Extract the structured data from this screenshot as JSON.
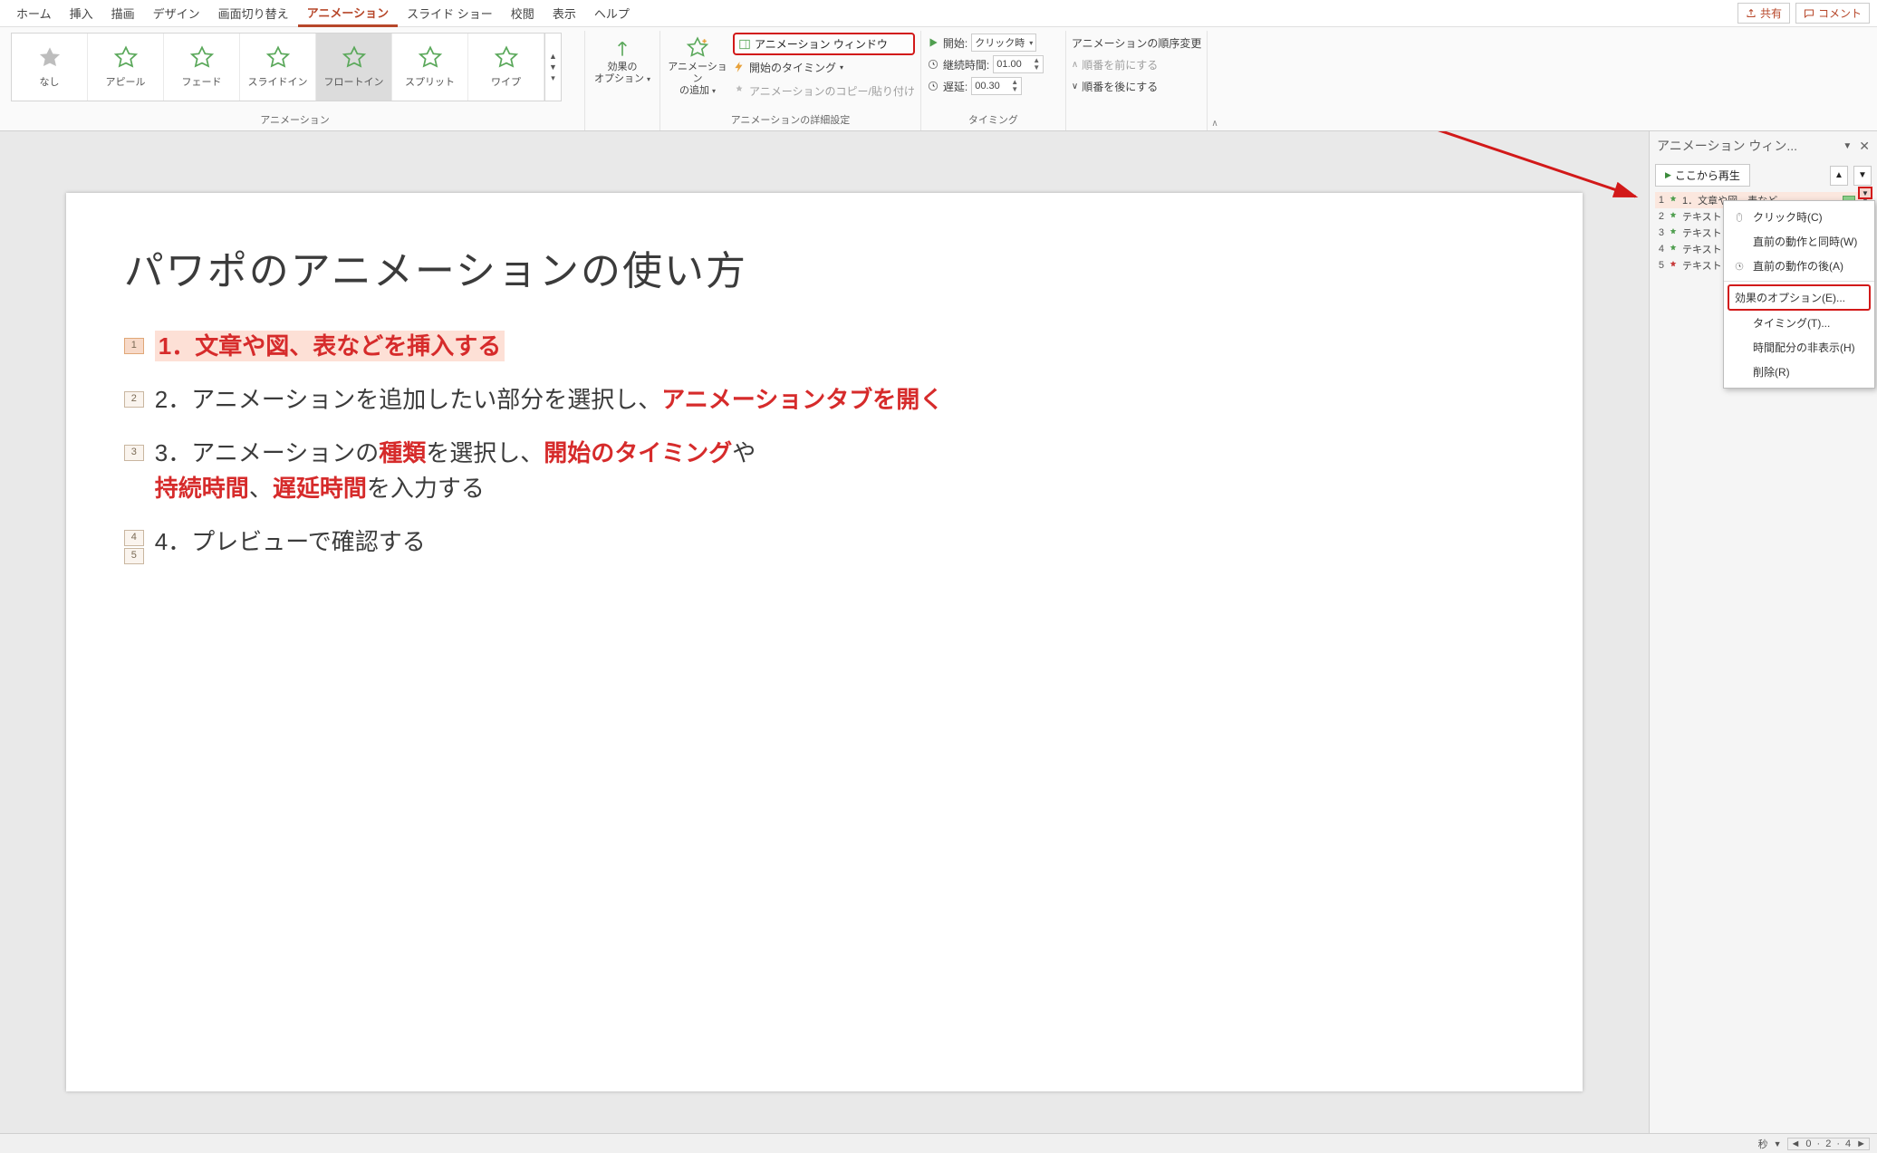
{
  "tabs": {
    "items": [
      "ホーム",
      "挿入",
      "描画",
      "デザイン",
      "画面切り替え",
      "アニメーション",
      "スライド ショー",
      "校閲",
      "表示",
      "ヘルプ"
    ],
    "active_index": 5,
    "share": "共有",
    "comment": "コメント"
  },
  "gallery": {
    "items": [
      {
        "label": "なし",
        "color": "#9e9e9e"
      },
      {
        "label": "アピール",
        "color": "#7fc77f"
      },
      {
        "label": "フェード",
        "color": "#7fc77f"
      },
      {
        "label": "スライドイン",
        "color": "#7fc77f"
      },
      {
        "label": "フロートイン",
        "color": "#7fc77f",
        "selected": true
      },
      {
        "label": "スプリット",
        "color": "#7fc77f"
      },
      {
        "label": "ワイプ",
        "color": "#7fc77f"
      }
    ],
    "group_label": "アニメーション"
  },
  "effect_options": {
    "line1": "効果の",
    "line2": "オプション"
  },
  "add_anim": {
    "line1": "アニメーション",
    "line2": "の追加"
  },
  "adv": {
    "pane_btn": "アニメーション ウィンドウ",
    "trigger": "開始のタイミング",
    "painter": "アニメーションのコピー/貼り付け",
    "group_label": "アニメーションの詳細設定"
  },
  "timing": {
    "start_label": "開始:",
    "start_value": "クリック時",
    "duration_label": "継続時間:",
    "duration_value": "01.00",
    "delay_label": "遅延:",
    "delay_value": "00.30",
    "reorder_label": "アニメーションの順序変更",
    "earlier": "順番を前にする",
    "later": "順番を後にする",
    "group_label": "タイミング"
  },
  "slide": {
    "title": "パワポのアニメーションの使い方",
    "rows": [
      {
        "tags": [
          "1"
        ],
        "num": "1．",
        "pre": "",
        "red": "文章や図、表などを挿入する",
        "post": "",
        "selected": true
      },
      {
        "tags": [
          "2"
        ],
        "num": "2．",
        "pre": "アニメーションを追加したい部分を選択し、",
        "red": "アニメーションタブを開く",
        "post": ""
      },
      {
        "tags": [
          "3"
        ],
        "num": "3．",
        "pre": "アニメーションの",
        "mid_red1": "種類",
        "mid_plain1": "を選択し、",
        "mid_red2": "開始のタイミング",
        "mid_plain2": "や",
        "mid_red3": "持続時間",
        "mid_plain3": "、",
        "mid_red4": "遅延時間",
        "post": "を入力する"
      },
      {
        "tags": [
          "4",
          "5"
        ],
        "num": "4．",
        "pre": "プレビューで確認する",
        "red": "",
        "post": ""
      }
    ]
  },
  "pane": {
    "title": "アニメーション ウィン...",
    "play": "ここから再生",
    "items": [
      {
        "idx": "1",
        "label": "1．文章や図、表など...",
        "sel": true,
        "bar": true
      },
      {
        "idx": "2",
        "label": "テキスト"
      },
      {
        "idx": "3",
        "label": "テキスト"
      },
      {
        "idx": "4",
        "label": "テキスト"
      },
      {
        "idx": "5",
        "label": "テキスト",
        "red": true
      }
    ]
  },
  "ctx": {
    "click": "クリック時(C)",
    "with_prev": "直前の動作と同時(W)",
    "after_prev": "直前の動作の後(A)",
    "effect": "効果のオプション(E)...",
    "timing_m": "タイミング(T)...",
    "hide": "時間配分の非表示(H)",
    "remove": "削除(R)"
  },
  "status": {
    "sec": "秒",
    "ticks": [
      "0",
      "2",
      "4"
    ]
  }
}
